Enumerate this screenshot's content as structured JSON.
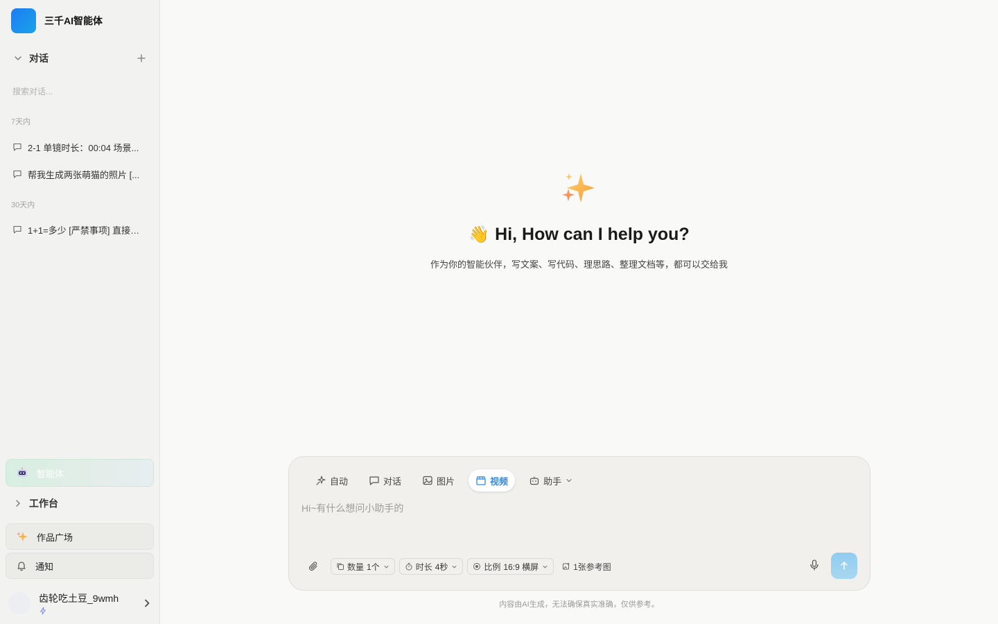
{
  "app": {
    "name": "三千AI智能体"
  },
  "sidebar": {
    "section_title": "对话",
    "search_placeholder": "搜索对话...",
    "groups": [
      {
        "label": "7天内",
        "items": [
          "2-1 单镜时长：00:04 场景...",
          "帮我生成两张萌猫的照片 [..."
        ]
      },
      {
        "label": "30天内",
        "items": [
          "1+1=多少 [严禁事项] 直接生..."
        ]
      }
    ],
    "agent_label": "智能体",
    "workbench_label": "工作台",
    "gallery_label": "作品广场",
    "notify_label": "通知",
    "user": {
      "name": "齿轮吃土豆_9wmh"
    }
  },
  "main": {
    "greeting_emoji": "👋",
    "greeting": "Hi, How can I help you?",
    "subtitle": "作为你的智能伙伴，写文案、写代码、理思路、整理文档等，都可以交给我",
    "modes": [
      {
        "label": "自动",
        "icon": "auto-sparkle-icon",
        "active": false
      },
      {
        "label": "对话",
        "icon": "chat-icon",
        "active": false
      },
      {
        "label": "图片",
        "icon": "image-icon",
        "active": false
      },
      {
        "label": "视频",
        "icon": "video-icon",
        "active": true
      },
      {
        "label": "助手",
        "icon": "robot-icon",
        "active": false
      }
    ],
    "prompt_placeholder": "Hi~有什么想问小助手的",
    "options": {
      "count_label": "数量",
      "count_value": "1个",
      "duration_label": "时长",
      "duration_value": "4秒",
      "ratio_label": "比例",
      "ratio_value": "16:9 横屏",
      "reference": "1张参考图"
    },
    "disclaimer": "内容由AI生成，无法确保真实准确，仅供参考。"
  },
  "colors": {
    "accent": "#2f8cec",
    "brand": "#1e7cf2",
    "send_button": "#a0d2ef",
    "agent_bg": "#d7efe1"
  }
}
